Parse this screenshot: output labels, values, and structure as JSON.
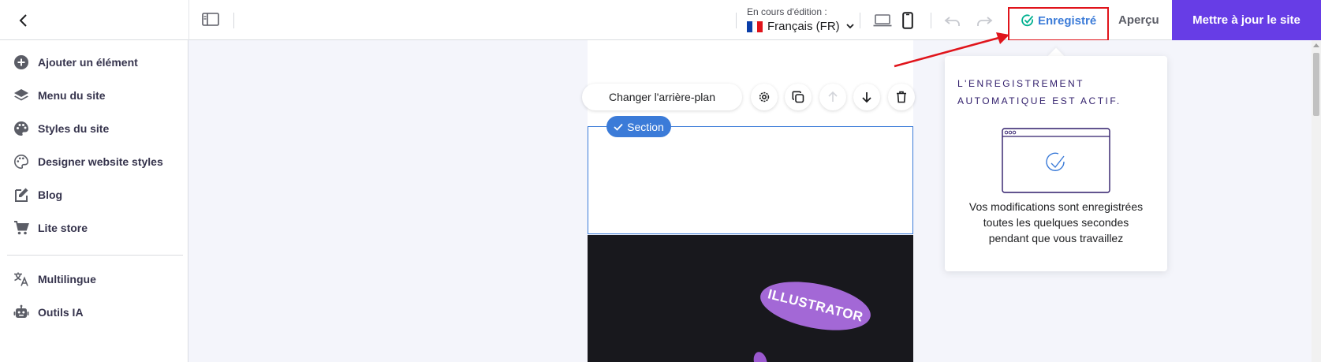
{
  "topbar": {
    "back_icon": "chevron-left-icon",
    "sidebar_toggle_icon": "sidebar-panel-icon",
    "language": {
      "caption": "En cours d'édition :",
      "value": "Français (FR)",
      "flag_colors": [
        "#0a3ea8",
        "#ffffff",
        "#e0141b"
      ]
    },
    "devices": [
      "laptop-icon",
      "mobile-icon"
    ],
    "undo_icon": "undo-icon",
    "redo_icon": "redo-icon",
    "saved_label": "Enregistré",
    "preview_label": "Aperçu",
    "update_label": "Mettre à jour le site",
    "colors": {
      "accent": "#673de6",
      "saved": "#3b7bd8",
      "highlight": "#e0141b"
    }
  },
  "sidebar": {
    "items": [
      {
        "label": "Ajouter un élément",
        "icon": "plus-circle-icon"
      },
      {
        "label": "Menu du site",
        "icon": "layers-icon"
      },
      {
        "label": "Styles du site",
        "icon": "palette-icon"
      },
      {
        "label": "Designer website styles",
        "icon": "palette-outline-icon"
      },
      {
        "label": "Blog",
        "icon": "edit-note-icon"
      },
      {
        "label": "Lite store",
        "icon": "cart-icon"
      },
      {
        "label": "Multilingue",
        "icon": "translate-icon"
      },
      {
        "label": "Outils IA",
        "icon": "robot-icon"
      }
    ]
  },
  "canvas": {
    "toolbar": {
      "change_background_label": "Changer l'arrière-plan",
      "tools": [
        "settings-icon",
        "duplicate-icon",
        "move-up-icon",
        "move-down-icon",
        "delete-icon"
      ]
    },
    "section_chip_label": "Section",
    "dark_section_text": "ILLUSTRATOR"
  },
  "popover": {
    "title": "L'ENREGISTREMENT AUTOMATIQUE EST ACTIF.",
    "body": "Vos modifications sont enregistrées toutes les quelques secondes pendant que vous travaillez",
    "illustration": "browser-window-check-icon"
  }
}
